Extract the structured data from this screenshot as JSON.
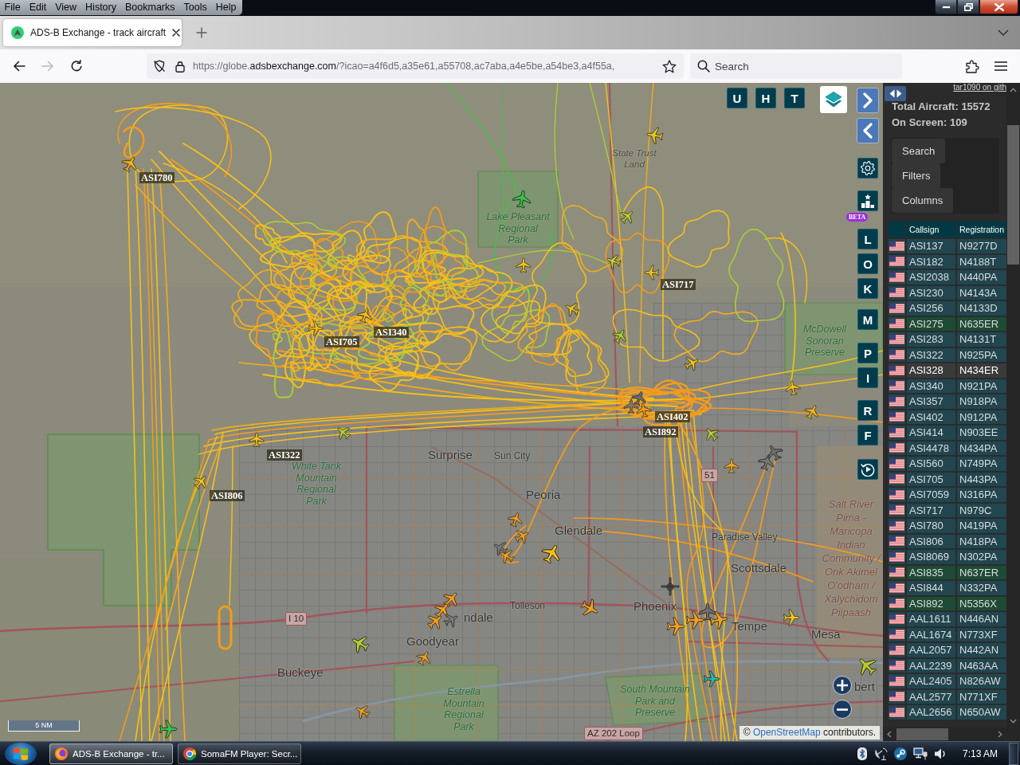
{
  "menu_bar": {
    "items": [
      "File",
      "Edit",
      "View",
      "History",
      "Bookmarks",
      "Tools",
      "Help"
    ]
  },
  "browser": {
    "tabs": [
      {
        "title": "ADS-B Exchange - track aircraft",
        "selected": true
      }
    ],
    "nav_buttons": [
      {
        "kind": "back",
        "disabled": false
      },
      {
        "kind": "forward",
        "disabled": true
      },
      {
        "kind": "reload",
        "disabled": false
      }
    ],
    "url": {
      "scheme": "https://globe.",
      "domain": "adsbexchange.com",
      "path": "/?icao=a4f6d5,a35e61,a55708,ac7aba,a4e5be,a54be3,a4f55a,"
    },
    "search": {
      "placeholder": "Search"
    }
  },
  "map": {
    "toggle_buttons": [
      {
        "label": "U"
      },
      {
        "label": "H"
      },
      {
        "label": "T"
      }
    ],
    "side_buttons": [
      {
        "label": "L"
      },
      {
        "label": "O"
      },
      {
        "label": "K"
      },
      {
        "label": "M"
      },
      {
        "label": "P"
      },
      {
        "label": "I"
      },
      {
        "label": "R"
      },
      {
        "label": "F"
      }
    ],
    "beta_badge": "BETA",
    "places": [
      {
        "kind": "area",
        "lines": [
          "State Trust",
          "Land"
        ]
      },
      {
        "kind": "park",
        "lines": [
          "Lake Pleasant",
          "Regional",
          "Park"
        ]
      },
      {
        "kind": "park",
        "lines": [
          "McDowell",
          "Sonoran",
          "Preserve"
        ]
      },
      {
        "kind": "park",
        "lines": [
          "White Tank",
          "Mountain",
          "Regional",
          "Park"
        ]
      },
      {
        "kind": "city",
        "lines": [
          "Surprise"
        ]
      },
      {
        "kind": "town",
        "lines": [
          "Sun City"
        ]
      },
      {
        "kind": "shield",
        "lines": [
          "51"
        ]
      },
      {
        "kind": "city",
        "lines": [
          "Peoria"
        ]
      },
      {
        "kind": "city",
        "lines": [
          "Glendale"
        ]
      },
      {
        "kind": "town",
        "lines": [
          "Paradise Valley"
        ]
      },
      {
        "kind": "city",
        "lines": [
          "Scottsdale"
        ]
      },
      {
        "kind": "town",
        "lines": [
          "Tolleson"
        ]
      },
      {
        "kind": "shield",
        "lines": [
          "I 10"
        ]
      },
      {
        "kind": "city",
        "lines": [
          "ndale"
        ]
      },
      {
        "kind": "city",
        "lines": [
          "Phoenix"
        ]
      },
      {
        "kind": "city",
        "lines": [
          "Tempe"
        ]
      },
      {
        "kind": "reserve",
        "lines": [
          "Salt River",
          "Pima -",
          "Maricopa",
          "Indian",
          "Community /",
          "Onk Akimel",
          "O'odham /",
          "Xalychidom",
          "Piipaash"
        ]
      },
      {
        "kind": "city",
        "lines": [
          "Goodyear"
        ]
      },
      {
        "kind": "city",
        "lines": [
          "Mesa"
        ]
      },
      {
        "kind": "city",
        "lines": [
          "Buckeye"
        ]
      },
      {
        "kind": "park",
        "lines": [
          "Estrella",
          "Mountain",
          "Regional",
          "Park"
        ]
      },
      {
        "kind": "park",
        "lines": [
          "South Mountain",
          "Park and",
          "Preserve"
        ]
      },
      {
        "kind": "city",
        "lines": [
          "bert"
        ]
      },
      {
        "kind": "shield",
        "lines": [
          "AZ 202 Loop"
        ]
      }
    ],
    "callsigns": [
      "ASI780",
      "ASI717",
      "ASI705",
      "ASI340",
      "ASI402",
      "ASI892",
      "ASI322",
      "ASI806"
    ],
    "aircraft": [
      {
        "kind": "plane",
        "color": "#f2b51c"
      },
      {
        "kind": "plane",
        "color": "#e3c71f"
      },
      {
        "kind": "plane",
        "color": "#3cc04a"
      },
      {
        "kind": "plane",
        "color": "#b8cc2c"
      },
      {
        "kind": "plane",
        "color": "#f0c21c"
      },
      {
        "kind": "plane",
        "color": "#c6cc28"
      },
      {
        "kind": "plane",
        "color": "#f3c01b"
      },
      {
        "kind": "plane",
        "color": "#f0c21c"
      },
      {
        "kind": "plane",
        "color": "#a8cf30"
      },
      {
        "kind": "plane",
        "color": "#f3c01b"
      },
      {
        "kind": "plane",
        "color": "#f0b81c"
      },
      {
        "kind": "plane",
        "color": "#f0c21c"
      },
      {
        "kind": "plane",
        "color": "#f3c01b"
      },
      {
        "kind": "plane",
        "color": "#f3b81c"
      },
      {
        "kind": "plane",
        "color": "#7a7a7a"
      },
      {
        "kind": "plane",
        "color": "#6e6e6e"
      },
      {
        "kind": "plane",
        "color": "#f39a1c"
      },
      {
        "kind": "plane",
        "color": "#b8cc2c"
      },
      {
        "kind": "plane",
        "color": "#7a7a7a"
      },
      {
        "kind": "plane",
        "color": "#6e6e6e"
      },
      {
        "kind": "plane",
        "color": "#f4a91c"
      },
      {
        "kind": "plane",
        "color": "#b8cc2c"
      },
      {
        "kind": "plane",
        "color": "#f0c21c"
      },
      {
        "kind": "plane",
        "color": "#f0c21c"
      },
      {
        "kind": "plane",
        "color": "#f4a01c"
      },
      {
        "kind": "plane",
        "color": "#f4a01c"
      },
      {
        "kind": "plane",
        "color": "#7a7a7a"
      },
      {
        "kind": "plane",
        "color": "#f4a01c"
      },
      {
        "kind": "plane",
        "color": "#f3c01b"
      },
      {
        "kind": "plane",
        "color": "#f4a01c"
      },
      {
        "kind": "plane",
        "color": "#f4a01c"
      },
      {
        "kind": "plane",
        "color": "#f4a01c"
      },
      {
        "kind": "plane",
        "color": "#f4a01c"
      },
      {
        "kind": "plane",
        "color": "#7a7a7a"
      },
      {
        "kind": "plane",
        "color": "#f4a01c"
      },
      {
        "kind": "plane",
        "color": "#b8cc2c"
      },
      {
        "kind": "plane",
        "color": "#f4a01c"
      },
      {
        "kind": "plane",
        "color": "#3cc04a"
      },
      {
        "kind": "helicopter",
        "color": "#5e5e5e"
      },
      {
        "kind": "plane",
        "color": "#f4a01c"
      },
      {
        "kind": "plane",
        "color": "#f4a01c"
      },
      {
        "kind": "plane",
        "color": "#6e6e6e"
      },
      {
        "kind": "plane",
        "color": "#f4a01c"
      },
      {
        "kind": "plane",
        "color": "#f0c21c"
      },
      {
        "kind": "plane",
        "color": "#2fb5a5"
      },
      {
        "kind": "plane",
        "color": "#b8cc2c"
      }
    ],
    "scale": "5 NM",
    "attribution": {
      "before": "© ",
      "link": "OpenStreetMap",
      "after": " contributors."
    }
  },
  "sidebar": {
    "link": "tar1090 on gith",
    "total_aircraft": "Total Aircraft: 15572",
    "on_screen": "On Screen: 109",
    "buttons": [
      "Search",
      "Filters",
      "Columns"
    ],
    "table": {
      "columns": [
        "Callsign",
        "Registration"
      ],
      "rows": [
        {
          "callsign": "ASI137",
          "registration": "N9277D",
          "selected": false,
          "hovered": false
        },
        {
          "callsign": "ASI182",
          "registration": "N4188T",
          "selected": false,
          "hovered": false
        },
        {
          "callsign": "ASI2038",
          "registration": "N440PA",
          "selected": false,
          "hovered": false
        },
        {
          "callsign": "ASI230",
          "registration": "N4143A",
          "selected": false,
          "hovered": false
        },
        {
          "callsign": "ASI256",
          "registration": "N4133D",
          "selected": false,
          "hovered": false
        },
        {
          "callsign": "ASI275",
          "registration": "N635ER",
          "selected": true,
          "hovered": false
        },
        {
          "callsign": "ASI283",
          "registration": "N4131T",
          "selected": false,
          "hovered": false
        },
        {
          "callsign": "ASI322",
          "registration": "N925PA",
          "selected": false,
          "hovered": false
        },
        {
          "callsign": "ASI328",
          "registration": "N434ER",
          "selected": false,
          "hovered": true
        },
        {
          "callsign": "ASI340",
          "registration": "N921PA",
          "selected": false,
          "hovered": false
        },
        {
          "callsign": "ASI357",
          "registration": "N918PA",
          "selected": false,
          "hovered": false
        },
        {
          "callsign": "ASI402",
          "registration": "N912PA",
          "selected": false,
          "hovered": false
        },
        {
          "callsign": "ASI414",
          "registration": "N903EE",
          "selected": false,
          "hovered": false
        },
        {
          "callsign": "ASI4478",
          "registration": "N434PA",
          "selected": false,
          "hovered": false
        },
        {
          "callsign": "ASI560",
          "registration": "N749PA",
          "selected": false,
          "hovered": false
        },
        {
          "callsign": "ASI705",
          "registration": "N443PA",
          "selected": false,
          "hovered": false
        },
        {
          "callsign": "ASI7059",
          "registration": "N316PA",
          "selected": false,
          "hovered": false
        },
        {
          "callsign": "ASI717",
          "registration": "N979C",
          "selected": false,
          "hovered": false
        },
        {
          "callsign": "ASI780",
          "registration": "N419PA",
          "selected": false,
          "hovered": false
        },
        {
          "callsign": "ASI806",
          "registration": "N418PA",
          "selected": false,
          "hovered": false
        },
        {
          "callsign": "ASI8069",
          "registration": "N302PA",
          "selected": false,
          "hovered": false
        },
        {
          "callsign": "ASI835",
          "registration": "N637ER",
          "selected": true,
          "hovered": false
        },
        {
          "callsign": "ASI844",
          "registration": "N332PA",
          "selected": false,
          "hovered": false
        },
        {
          "callsign": "ASI892",
          "registration": "N5356X",
          "selected": true,
          "hovered": false
        },
        {
          "callsign": "AAL1611",
          "registration": "N446AN",
          "selected": false,
          "hovered": false
        },
        {
          "callsign": "AAL1674",
          "registration": "N773XF",
          "selected": false,
          "hovered": false
        },
        {
          "callsign": "AAL2057",
          "registration": "N442AN",
          "selected": false,
          "hovered": false
        },
        {
          "callsign": "AAL2239",
          "registration": "N463AA",
          "selected": false,
          "hovered": false
        },
        {
          "callsign": "AAL2405",
          "registration": "N826AW",
          "selected": false,
          "hovered": false
        },
        {
          "callsign": "AAL2577",
          "registration": "N771XF",
          "selected": false,
          "hovered": false
        },
        {
          "callsign": "AAL2656",
          "registration": "N650AW",
          "selected": false,
          "hovered": false
        }
      ]
    }
  },
  "taskbar": {
    "tasks": [
      {
        "kind": "swirl",
        "label": "ADS-B Exchange - tr...",
        "selected": true
      },
      {
        "kind": "ring",
        "label": "SomaFM Player: Secr...",
        "selected": false
      }
    ],
    "clock": "7:13 AM"
  }
}
